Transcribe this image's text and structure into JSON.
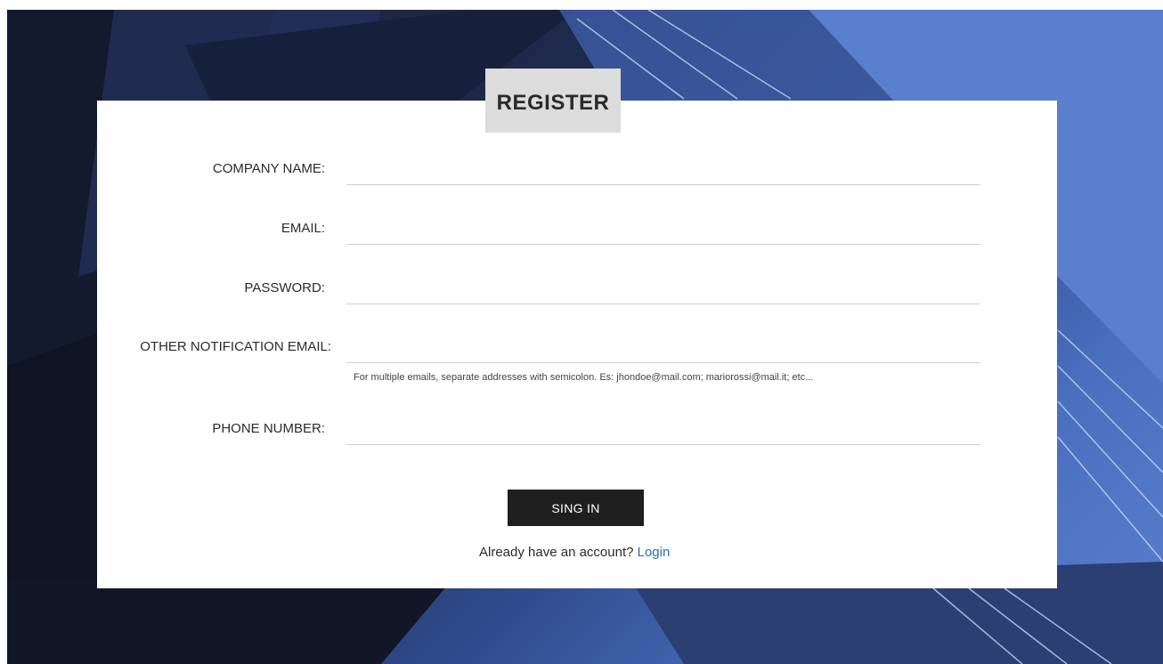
{
  "header": {
    "title": "REGISTER"
  },
  "form": {
    "company_label": "COMPANY NAME:",
    "email_label": "EMAIL:",
    "password_label": "PASSWORD:",
    "other_email_label": "OTHER NOTIFICATION EMAIL:",
    "other_email_hint": "For multiple emails, separate addresses with semicolon. Es: jhondoe@mail.com; mariorossi@mail.it; etc...",
    "phone_label": "PHONE NUMBER:",
    "submit_label": "SING IN",
    "login_prompt": "Already have an account?",
    "login_link": "Login"
  },
  "colors": {
    "button": "#1f1f1f",
    "link": "#2a6fb0",
    "tab": "#dcdcdc"
  }
}
